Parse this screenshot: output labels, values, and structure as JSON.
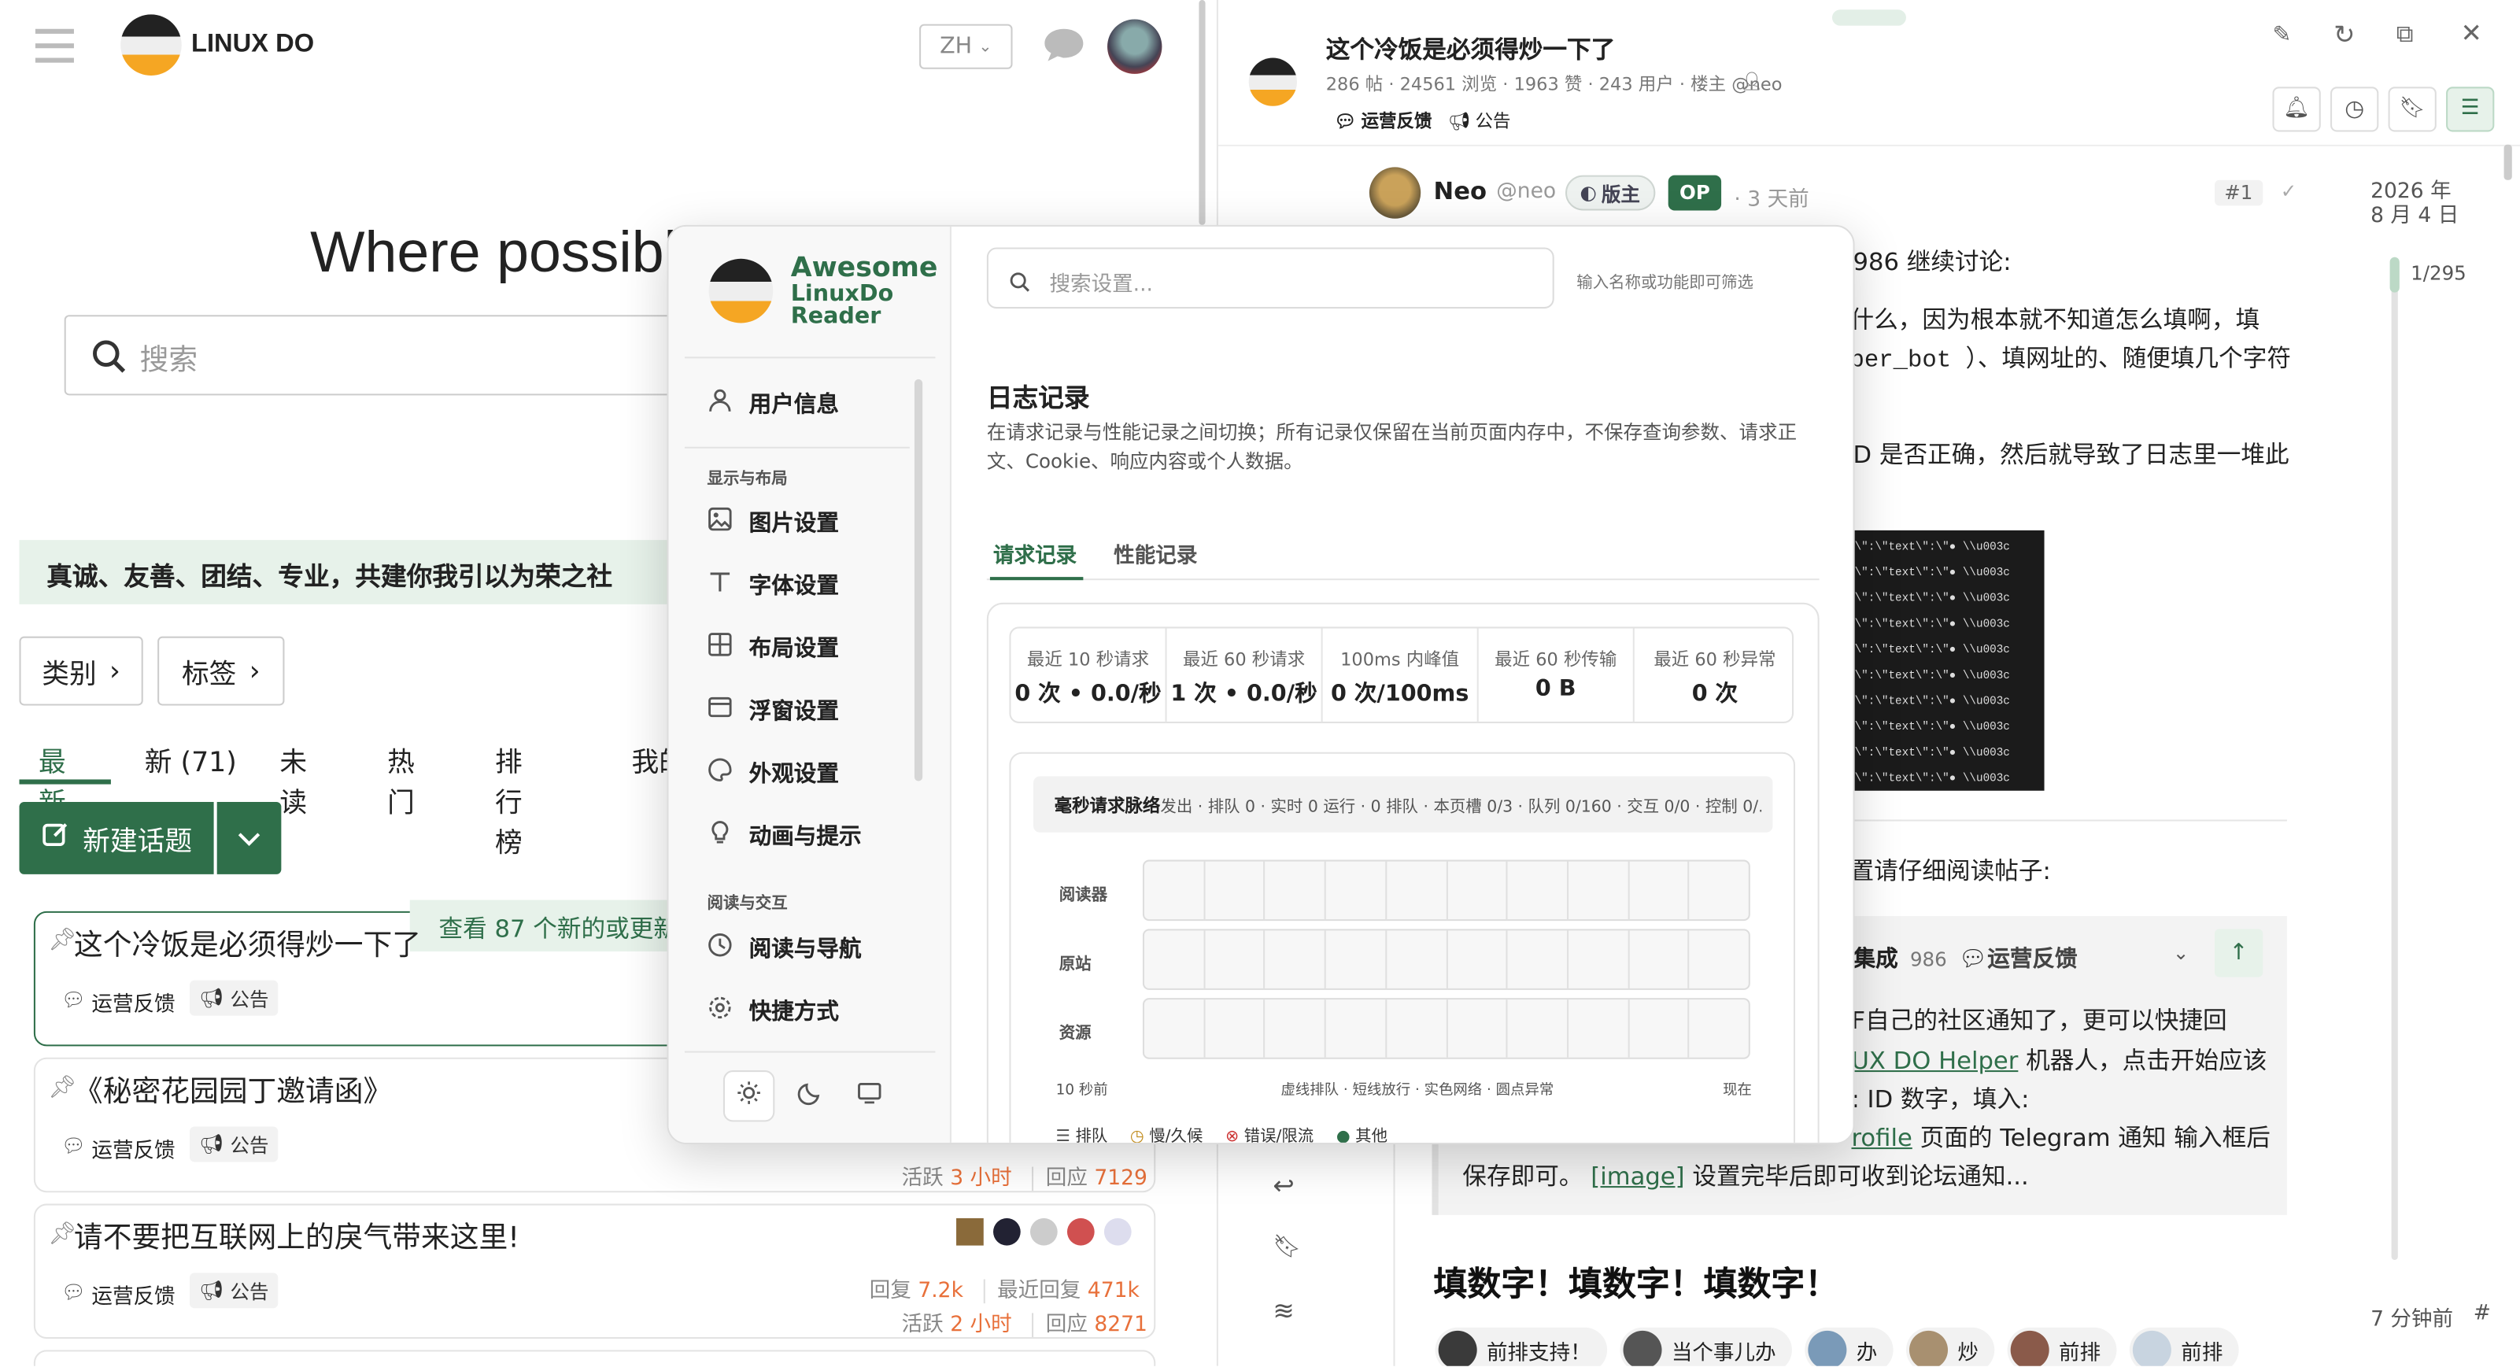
{
  "left": {
    "site_name": "LINUX DO",
    "lang_label": "ZH",
    "hero_heading": "Where possibl",
    "search_placeholder": "搜索",
    "slogan": "真诚、友善、团结、专业，共建你我引以为荣之社",
    "category_btn": "类别",
    "tags_btn": "标签",
    "nav_tabs": [
      "最新",
      "新 (71)",
      "未读",
      "热门",
      "排行榜",
      "我的"
    ],
    "new_topic_btn": "新建话题",
    "new_notice": "查看 87 个新的或更新",
    "topics": [
      {
        "title": "这个冷饭是必须得炒一下了",
        "cat": "运营反馈",
        "tag": "公告"
      },
      {
        "title": "《秘密花园园丁邀请函》",
        "cat": "运营反馈",
        "tag": "公告",
        "active_label": "活跃",
        "active_val": "3 小时",
        "reply_label": "回应",
        "reply_val": "7129"
      },
      {
        "title": "请不要把互联网上的戾气带来这里!",
        "cat": "运营反馈",
        "tag": "公告",
        "replies_label": "回复",
        "replies_val": "7.2k",
        "recent_label": "最近回复",
        "recent_val": "471k",
        "active_label": "活跃",
        "active_val": "2 小时",
        "reply_label": "回应",
        "reply_val": "8271"
      }
    ]
  },
  "right": {
    "title": "这个冷饭是必须得炒一下了",
    "meta": "286 帖 · 24561 浏览 · 1963 赞 · 243 用户 · 楼主 @neo",
    "cat": "运营反馈",
    "tag": "公告",
    "author": "Neo",
    "handle": "@neo",
    "role_badge": "版主",
    "op_badge": "OP",
    "time_ago": "· 3 天前",
    "post_no": "#1",
    "date_line1": "2026 年",
    "date_line2": "8 月 4 日",
    "progress": "1/295",
    "progress_fraction": 0.0034,
    "post_frag1": "986 继续讨论:",
    "post_frag2": "什么，因为根本就不知道怎么填啊，填",
    "post_frag3": "per_bot ）、填网址的、随便填几个字符",
    "post_frag4": "D 是否正确，然后就导致了日志里一堆此",
    "term_line": "\\\":\\\"text\\\":\\\"● \\\\u003c",
    "post_frag5": "置请仔细阅读帖子:",
    "quote_head_a": "集成",
    "quote_head_b": "986",
    "quote_head_c": "运营反馈",
    "quote_l1": "F自己的社区通知了，更可以快捷回",
    "quote_l2a": "UX DO Helper",
    "quote_l2b": "机器人，点击开始应该",
    "quote_l3": ": ID 数字，填入:",
    "quote_l4a": "rofile",
    "quote_l4b": "页面的 Telegram 通知 输入框后",
    "quote_l5a": "保存即可。",
    "quote_l5b": "[image]",
    "quote_l5c": "设置完毕后即可收到论坛通知...",
    "heading": "填数字！填数字！填数字！",
    "reply_chips": [
      "前排支持！",
      "当个事儿办",
      "办",
      "炒",
      "前排",
      "前排"
    ],
    "footer_time": "7 分钟前",
    "footer_hash": "#"
  },
  "modal": {
    "brand_line1": "Awesome",
    "brand_line2": "LinuxDo",
    "brand_line3": "Reader",
    "user_info": "用户信息",
    "section_display": "显示与布局",
    "image_settings": "图片设置",
    "font_settings": "字体设置",
    "layout_settings": "布局设置",
    "float_settings": "浮窗设置",
    "appearance_settings": "外观设置",
    "anim_settings": "动画与提示",
    "section_read": "阅读与交互",
    "read_nav": "阅读与导航",
    "shortcuts": "快捷方式",
    "search_placeholder": "搜索设置...",
    "search_hint": "输入名称或功能即可筛选",
    "section_title": "日志记录",
    "section_desc": "在请求记录与性能记录之间切换；所有记录仅保留在当前页面内存中，不保存查询参数、请求正文、Cookie、响应内容或个人数据。",
    "tab_requests": "请求记录",
    "tab_perf": "性能记录",
    "stats": [
      {
        "label": "最近 10 秒请求",
        "value": "0 次 • 0.0/秒"
      },
      {
        "label": "最近 60 秒请求",
        "value": "1 次 • 0.0/秒"
      },
      {
        "label": "100ms 内峰值",
        "value": "0 次/100ms"
      },
      {
        "label": "最近 60 秒传输",
        "value": "0 B"
      },
      {
        "label": "最近 60 秒异常",
        "value": "0 次"
      }
    ],
    "pulse_title": "毫秒请求脉络",
    "pulse_meta": "发出 · 排队 0 · 实时 0 运行 · 0 排队 · 本页槽 0/3 · 队列 0/160 · 交互 0/0 · 控制 0/...",
    "lanes": [
      "阅读器",
      "原站",
      "资源"
    ],
    "axis_left": "10 秒前",
    "axis_mid": "虚线排队 · 短线放行 · 实色网络 · 圆点异常",
    "axis_right": "现在",
    "legend": [
      "排队",
      "慢/久候",
      "错误/限流",
      "其他"
    ]
  },
  "colors": {
    "brand_green": "#2f6f4a",
    "accent_orange": "#e8703a"
  }
}
